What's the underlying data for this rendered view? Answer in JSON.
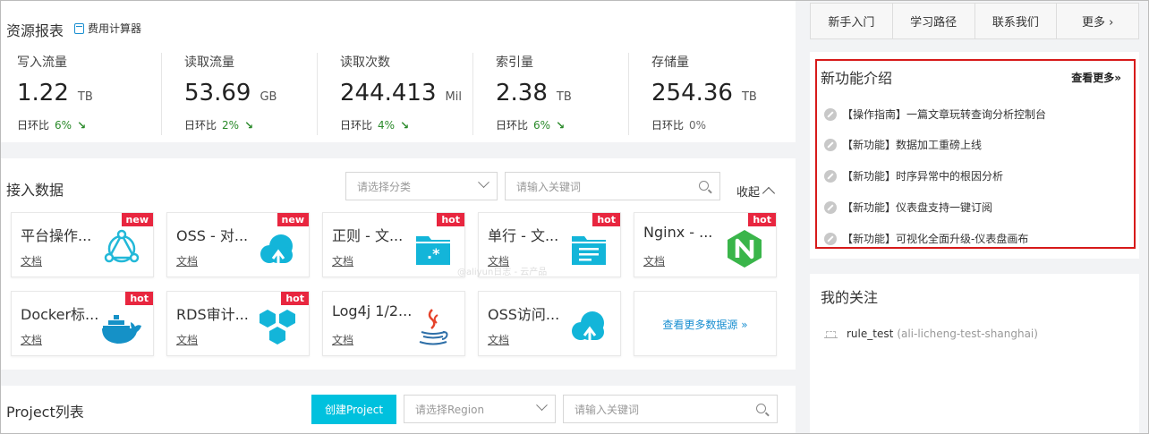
{
  "resources": {
    "title": "资源报表",
    "calc_link": "费用计算器",
    "metrics": [
      {
        "label": "写入流量",
        "value": "1.22",
        "unit": "TB",
        "compare_label": "日环比",
        "pct": "6%",
        "trend": "down"
      },
      {
        "label": "读取流量",
        "value": "53.69",
        "unit": "GB",
        "compare_label": "日环比",
        "pct": "2%",
        "trend": "down"
      },
      {
        "label": "读取次数",
        "value": "244.413",
        "unit": "Mil",
        "compare_label": "日环比",
        "pct": "4%",
        "trend": "down"
      },
      {
        "label": "索引量",
        "value": "2.38",
        "unit": "TB",
        "compare_label": "日环比",
        "pct": "6%",
        "trend": "down"
      },
      {
        "label": "存储量",
        "value": "254.36",
        "unit": "TB",
        "compare_label": "日环比",
        "pct": "0%",
        "trend": "none"
      }
    ]
  },
  "access": {
    "title": "接入数据",
    "category_placeholder": "请选择分类",
    "keyword_placeholder": "请输入关键词",
    "collapse_label": "收起",
    "watermark": "@aliyun日志 - 云产品",
    "cards": [
      {
        "title": "平台操作...",
        "doc": "文档",
        "badge": "new",
        "icon": "network-icon"
      },
      {
        "title": "OSS - 对...",
        "doc": "文档",
        "badge": "new",
        "icon": "cloud-upload-icon"
      },
      {
        "title": "正则 - 文...",
        "doc": "文档",
        "badge": "hot",
        "icon": "folder-regex-icon"
      },
      {
        "title": "单行 - 文...",
        "doc": "文档",
        "badge": "hot",
        "icon": "folder-lines-icon"
      },
      {
        "title": "Nginx - ...",
        "doc": "文档",
        "badge": "hot",
        "icon": "nginx-icon"
      },
      {
        "title": "Docker标...",
        "doc": "文档",
        "badge": "hot",
        "icon": "docker-icon"
      },
      {
        "title": "RDS审计...",
        "doc": "文档",
        "badge": "hot",
        "icon": "hexagons-icon"
      },
      {
        "title": "Log4j 1/2...",
        "doc": "文档",
        "badge": "",
        "icon": "java-icon"
      },
      {
        "title": "OSS访问...",
        "doc": "文档",
        "badge": "",
        "icon": "cloud-upload-icon"
      }
    ],
    "more_sources": "查看更多数据源 »"
  },
  "projects": {
    "title": "Project列表",
    "create_button": "创建Project",
    "region_placeholder": "请选择Region",
    "keyword_placeholder": "请输入关键词"
  },
  "topnav": [
    "新手入门",
    "学习路径",
    "联系我们",
    "更多 ›"
  ],
  "new_features": {
    "title": "新功能介绍",
    "see_more": "查看更多»",
    "items": [
      "【操作指南】一篇文章玩转查询分析控制台",
      "【新功能】数据加工重磅上线",
      "【新功能】时序异常中的根因分析",
      "【新功能】仪表盘支持一键订阅",
      "【新功能】可视化全面升级-仪表盘画布"
    ]
  },
  "follow": {
    "title": "我的关注",
    "items": [
      {
        "name": "rule_test",
        "sub": "(ali-licheng-test-shanghai)"
      }
    ]
  }
}
